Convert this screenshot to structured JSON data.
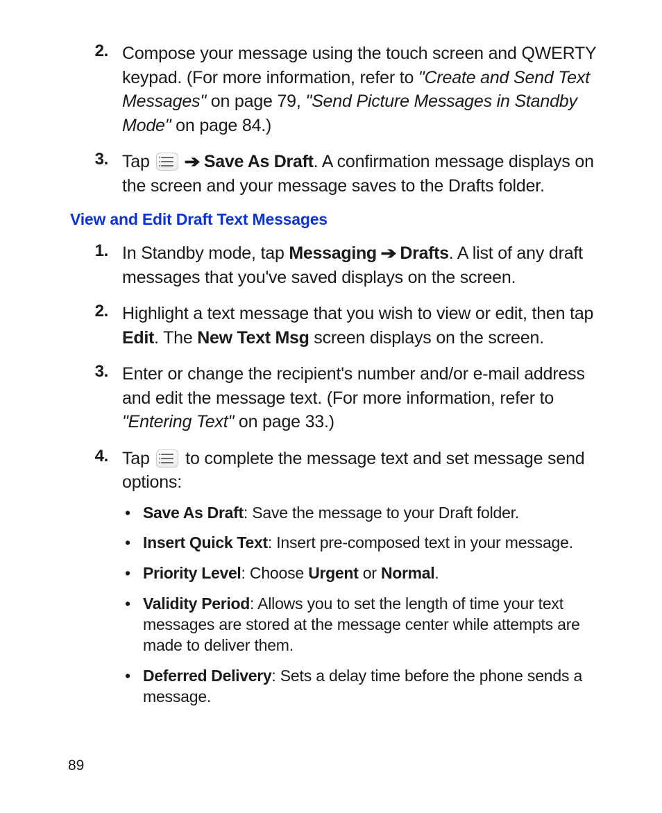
{
  "page_number": "89",
  "top_steps": [
    {
      "marker": "2.",
      "body": [
        {
          "t": "Compose your message using the touch screen and QWERTY keypad. (For more information, refer to "
        },
        {
          "t": "\"Create and Send Text Messages\"",
          "style": "it"
        },
        {
          "t": " on page 79, "
        },
        {
          "t": "\"Send Picture Messages in Standby Mode\"",
          "style": "it"
        },
        {
          "t": " on page 84.)"
        }
      ]
    },
    {
      "marker": "3.",
      "body": [
        {
          "t": "Tap "
        },
        {
          "icon": "menu"
        },
        {
          "t": " "
        },
        {
          "arrow": true
        },
        {
          "t": " "
        },
        {
          "t": "Save As Draft",
          "style": "b"
        },
        {
          "t": ". A confirmation message displays on the screen and your message saves to the Drafts folder."
        }
      ]
    }
  ],
  "section_heading": "View and Edit Draft Text Messages",
  "section_steps": [
    {
      "marker": "1.",
      "body": [
        {
          "t": "In Standby mode, tap "
        },
        {
          "t": "Messaging",
          "style": "b"
        },
        {
          "t": " "
        },
        {
          "arrow": true
        },
        {
          "t": " "
        },
        {
          "t": "Drafts",
          "style": "b"
        },
        {
          "t": ". A list of any draft messages that you've saved displays on the screen."
        }
      ]
    },
    {
      "marker": "2.",
      "body": [
        {
          "t": "Highlight a text message that you wish to view or edit, then tap "
        },
        {
          "t": "Edit",
          "style": "b"
        },
        {
          "t": ". The "
        },
        {
          "t": "New Text Msg",
          "style": "b"
        },
        {
          "t": " screen displays on the screen."
        }
      ]
    },
    {
      "marker": "3.",
      "body": [
        {
          "t": "Enter or change the recipient's number and/or e-mail address and edit the message text. (For more information, refer to "
        },
        {
          "t": "\"Entering Text\"",
          "style": "it"
        },
        {
          "t": " on page 33.)"
        }
      ]
    },
    {
      "marker": "4.",
      "body": [
        {
          "t": "Tap "
        },
        {
          "icon": "menu"
        },
        {
          "t": " to complete the message text and set message send options:"
        }
      ],
      "bullets": [
        [
          {
            "t": "Save As Draft",
            "style": "b"
          },
          {
            "t": ": Save the message to your Draft folder."
          }
        ],
        [
          {
            "t": "Insert Quick Text",
            "style": "b"
          },
          {
            "t": ": Insert pre-composed text in your message."
          }
        ],
        [
          {
            "t": "Priority Level",
            "style": "b"
          },
          {
            "t": ": Choose "
          },
          {
            "t": "Urgent",
            "style": "b"
          },
          {
            "t": " or "
          },
          {
            "t": "Normal",
            "style": "b"
          },
          {
            "t": "."
          }
        ],
        [
          {
            "t": "Validity Period",
            "style": "b"
          },
          {
            "t": ": Allows you to set the length of time your text messages are stored at the message center while attempts are made to deliver them."
          }
        ],
        [
          {
            "t": "Deferred Delivery",
            "style": "b"
          },
          {
            "t": ": Sets a delay time before the phone sends a message."
          }
        ]
      ]
    }
  ]
}
